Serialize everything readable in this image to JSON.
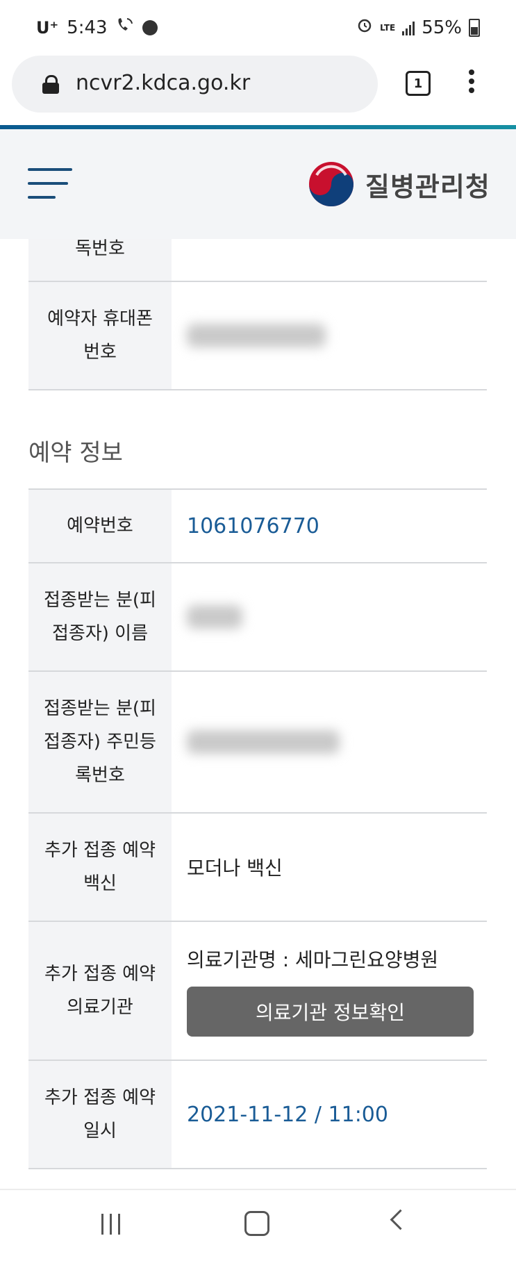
{
  "status_bar": {
    "carrier": "U⁺",
    "time": "5:43",
    "battery": "55%",
    "network": "LTE"
  },
  "browser": {
    "url": "ncvr2.kdca.go.kr",
    "tab_count": "1"
  },
  "site": {
    "logo_text": "질병관리청"
  },
  "top_rows": [
    {
      "label_lines": [
        "독번호"
      ]
    },
    {
      "label_lines": [
        "예약자 휴대폰",
        "번호"
      ]
    }
  ],
  "reservation": {
    "section_title": "예약 정보",
    "number_label": "예약번호",
    "number_value": "1061076770",
    "name_label_lines": [
      "접종받는 분(피",
      "접종자) 이름"
    ],
    "rrn_label_lines": [
      "접종받는 분(피",
      "접종자) 주민등",
      "록번호"
    ],
    "vaccine_label_lines": [
      "추가 접종 예약",
      "백신"
    ],
    "vaccine_value": "모더나 백신",
    "institution_label_lines": [
      "추가 접종 예약",
      "의료기관"
    ],
    "institution_value": "의료기관명 : 세마그린요양병원",
    "institution_button": "의료기관 정보확인",
    "datetime_label_lines": [
      "추가 접종 예약",
      "일시"
    ],
    "datetime_value": "2021-11-12 / 11:00"
  }
}
